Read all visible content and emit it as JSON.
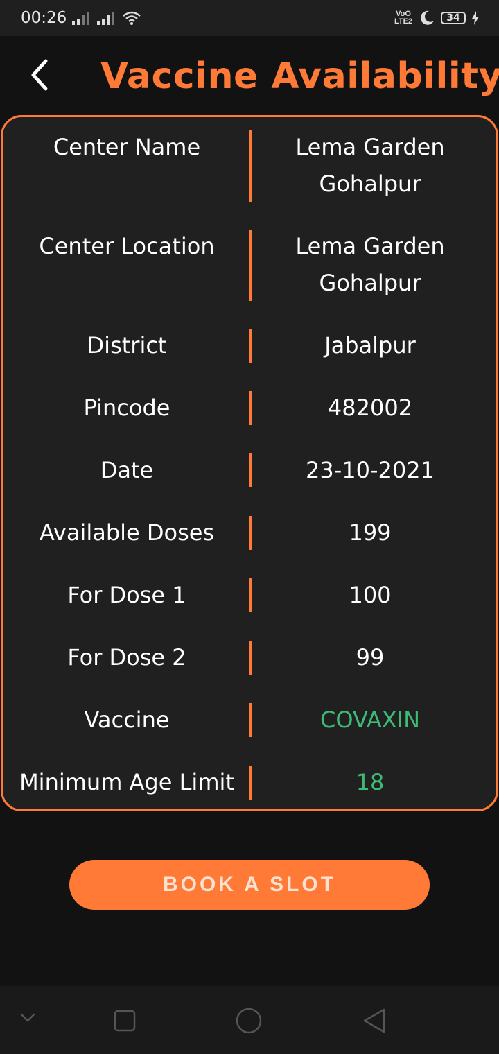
{
  "status_bar": {
    "time": "00:26",
    "volte_top": "VoO",
    "volte_bottom": "LTE2",
    "battery": "34",
    "icons": [
      "signal-icon",
      "signal-icon",
      "wifi-icon",
      "moon-icon",
      "battery-icon",
      "charging-icon"
    ]
  },
  "header": {
    "title": "Vaccine Availability",
    "back_icon": "chevron-left-icon"
  },
  "details": [
    {
      "label": "Center Name",
      "value": "Lema Garden\nGohalpur"
    },
    {
      "label": "Center Location",
      "value": "Lema Garden\nGohalpur"
    },
    {
      "label": "District",
      "value": "Jabalpur"
    },
    {
      "label": "Pincode",
      "value": "482002"
    },
    {
      "label": "Date",
      "value": "23-10-2021"
    },
    {
      "label": "Available Doses",
      "value": "199"
    },
    {
      "label": "For Dose 1",
      "value": "100"
    },
    {
      "label": "For Dose 2",
      "value": "99"
    },
    {
      "label": "Vaccine",
      "value": "COVAXIN"
    },
    {
      "label": "Minimum Age Limit",
      "value": "18"
    }
  ],
  "book_button": {
    "label": "BOOK A SLOT"
  },
  "colors": {
    "accent": "#ff7a36",
    "green": "#3dba76",
    "background": "#121212",
    "card": "#202020"
  },
  "nav_bar": {
    "icons": [
      "chevron-down-icon",
      "square-icon",
      "circle-icon",
      "triangle-back-icon"
    ]
  }
}
